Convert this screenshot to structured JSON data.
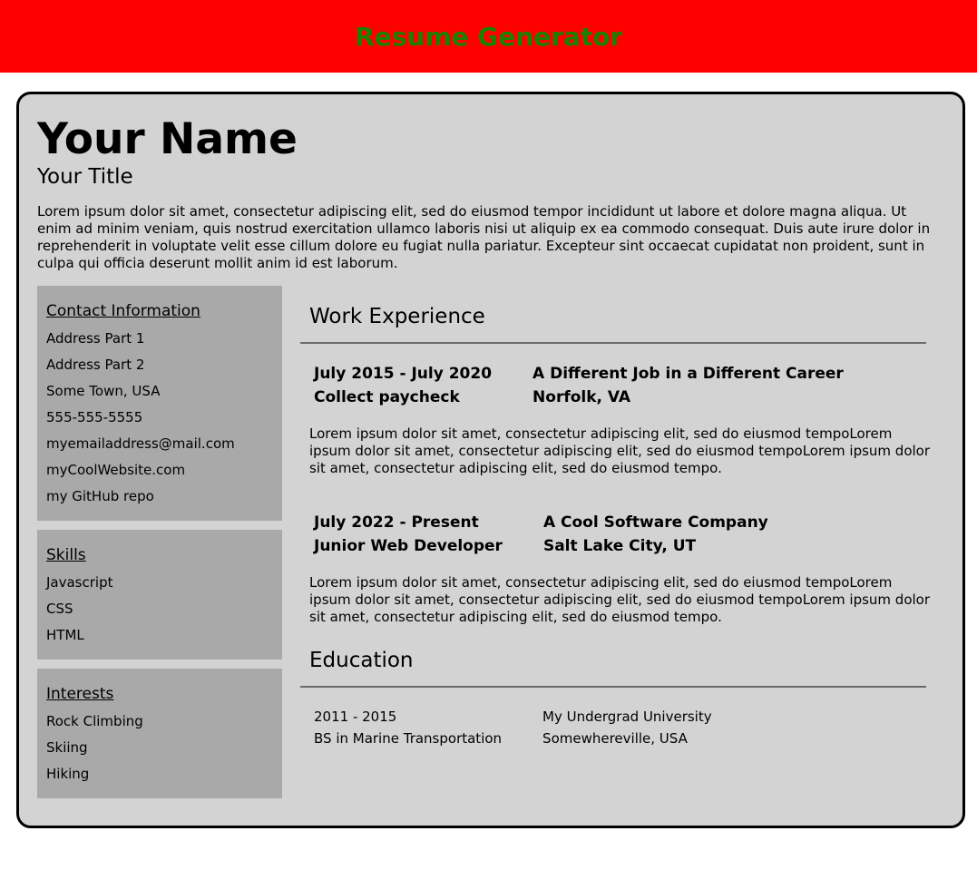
{
  "header": {
    "title": "Resume Generator"
  },
  "resume": {
    "name": "Your Name",
    "title": "Your Title",
    "summary": "Lorem ipsum dolor sit amet, consectetur adipiscing elit, sed do eiusmod tempor incididunt ut labore et dolore magna aliqua. Ut enim ad minim veniam, quis nostrud exercitation ullamco laboris nisi ut aliquip ex ea commodo consequat. Duis aute irure dolor in reprehenderit in voluptate velit esse cillum dolore eu fugiat nulla pariatur. Excepteur sint occaecat cupidatat non proident, sunt in culpa qui officia deserunt mollit anim id est laborum."
  },
  "sidebar": {
    "contact": {
      "heading": "Contact Information",
      "items": [
        "Address Part 1",
        "Address Part 2",
        "Some Town, USA",
        "555-555-5555",
        "myemailaddress@mail.com",
        "myCoolWebsite.com",
        "my GitHub repo"
      ]
    },
    "skills": {
      "heading": "Skills",
      "items": [
        "Javascript",
        "CSS",
        "HTML"
      ]
    },
    "interests": {
      "heading": "Interests",
      "items": [
        "Rock Climbing",
        "Skiing",
        "Hiking"
      ]
    }
  },
  "work": {
    "heading": "Work Experience",
    "jobs": [
      {
        "dates": "July 2015 - July 2020",
        "company": "A Different Job in a Different Career",
        "role": "Collect paycheck",
        "location": "Norfolk, VA",
        "description": "Lorem ipsum dolor sit amet, consectetur adipiscing elit, sed do eiusmod tempoLorem ipsum dolor sit amet, consectetur adipiscing elit, sed do eiusmod tempoLorem ipsum dolor sit amet, consectetur adipiscing elit, sed do eiusmod tempo."
      },
      {
        "dates": "July 2022 - Present",
        "company": "A Cool Software Company",
        "role": "Junior Web Developer",
        "location": "Salt Lake City, UT",
        "description": "Lorem ipsum dolor sit amet, consectetur adipiscing elit, sed do eiusmod tempoLorem ipsum dolor sit amet, consectetur adipiscing elit, sed do eiusmod tempoLorem ipsum dolor sit amet, consectetur adipiscing elit, sed do eiusmod tempo."
      }
    ]
  },
  "education": {
    "heading": "Education",
    "entries": [
      {
        "dates": "2011 - 2015",
        "school": "My Undergrad University",
        "degree": "BS in Marine Transportation",
        "location": "Somewhereville, USA"
      }
    ]
  },
  "colors": {
    "header_bg": "#ff0000",
    "header_text": "#1f7f00",
    "card_bg": "#d3d3d3",
    "sidebar_bg": "#a9a9a9"
  }
}
